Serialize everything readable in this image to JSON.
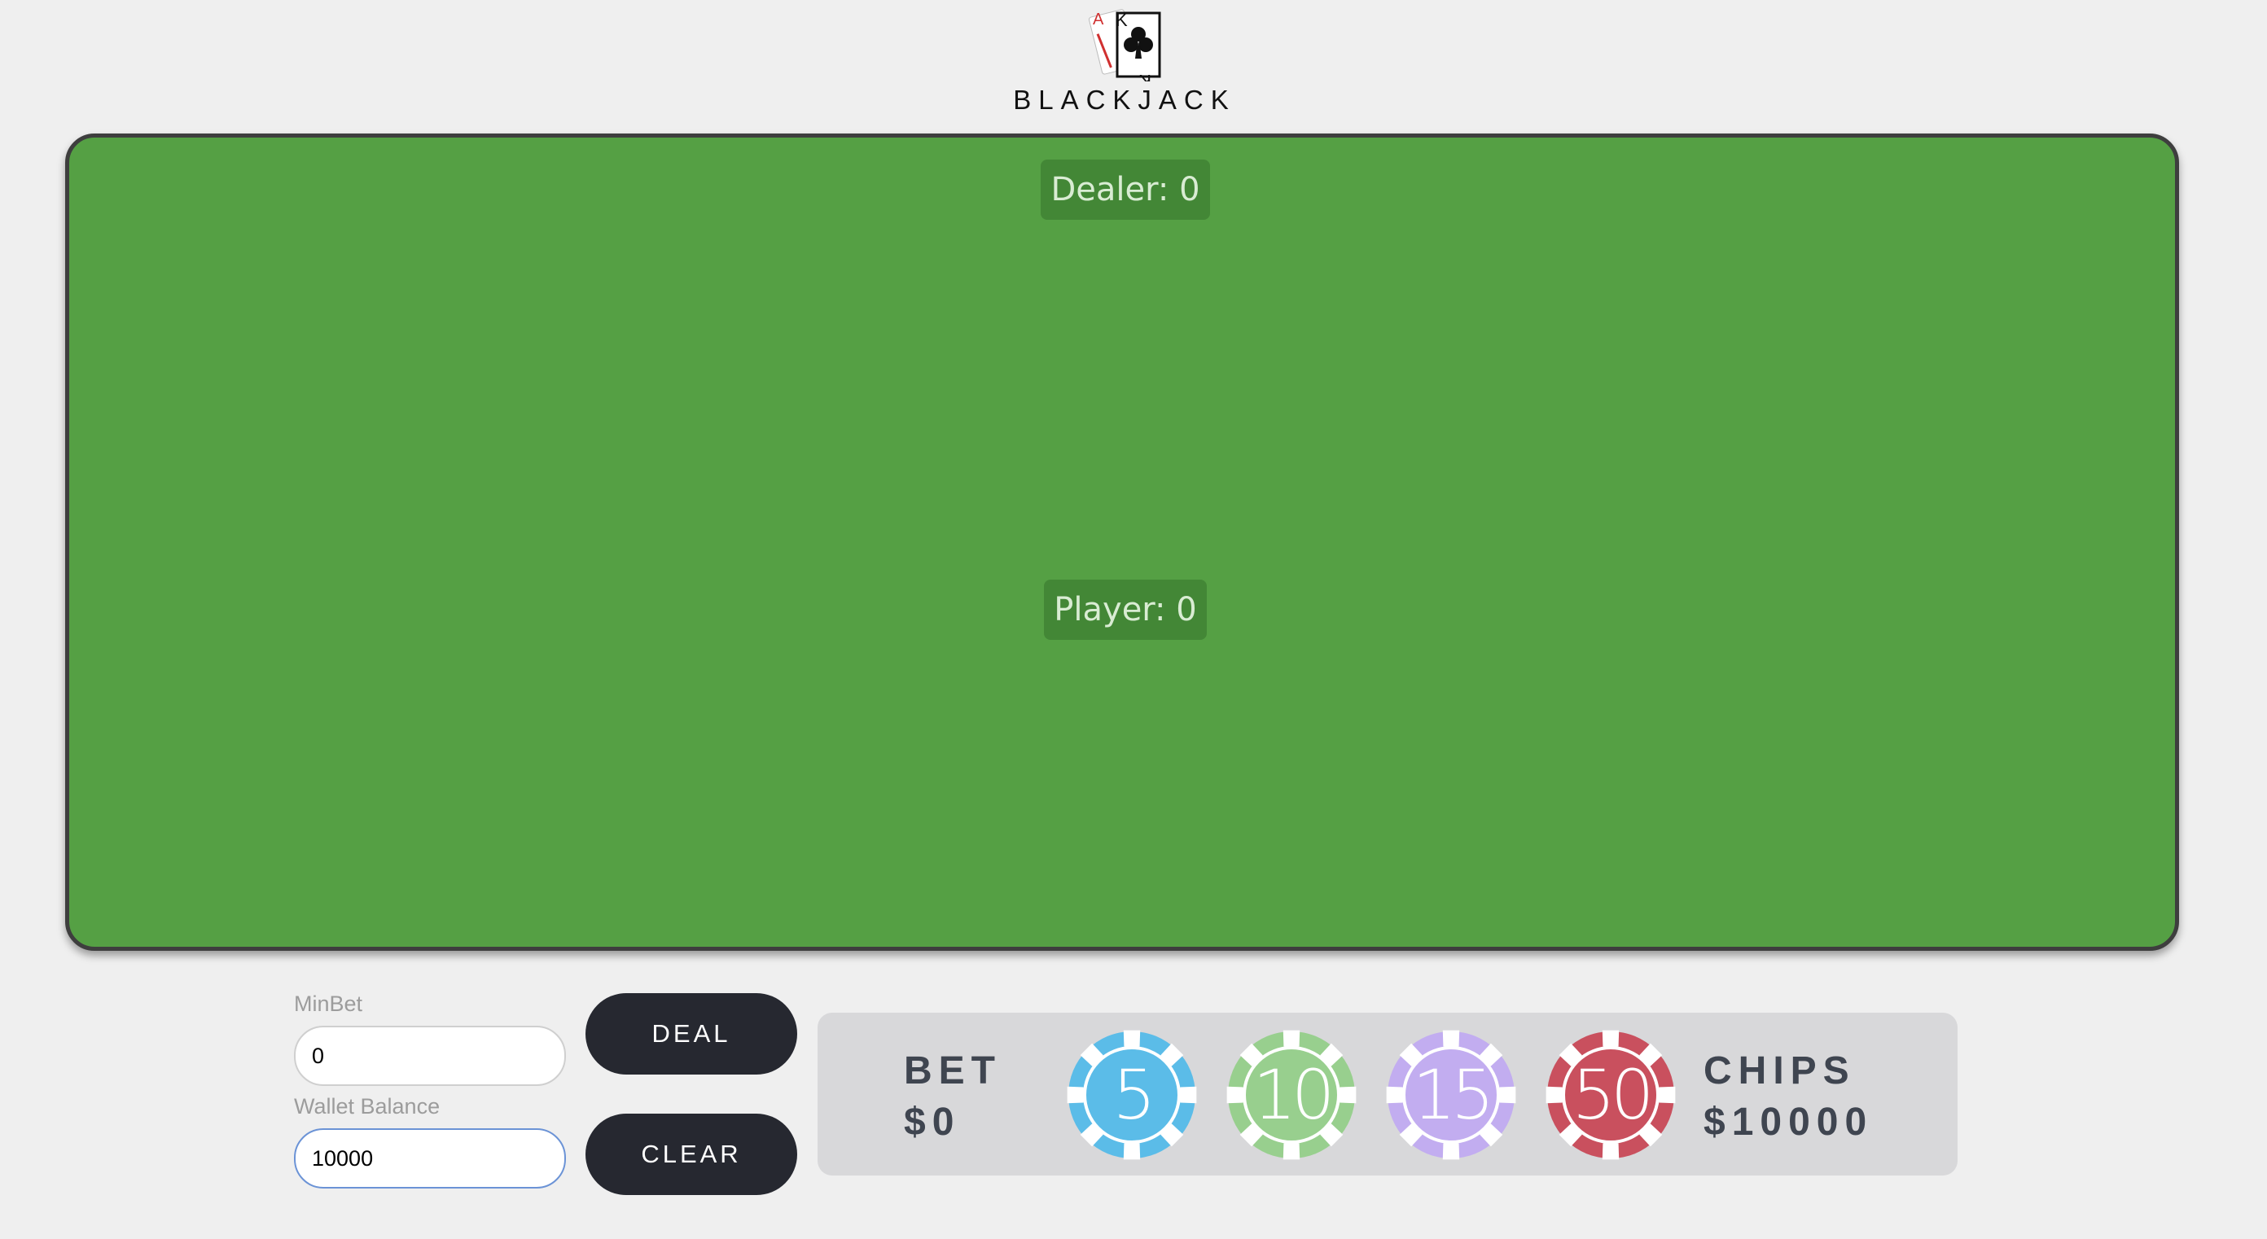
{
  "header": {
    "title": "BLACKJACK",
    "logo_icon": "ace-king-of-clubs-cards-icon",
    "logo_letters": [
      "A",
      "K",
      "K"
    ]
  },
  "table": {
    "felt_color": "#55a044",
    "dealer_score": "Dealer: 0",
    "player_score": "Player: 0"
  },
  "controls": {
    "minbet_label": "MinBet",
    "minbet_value": "0",
    "wallet_label": "Wallet Balance",
    "wallet_value": "10000",
    "deal_label": "DEAL",
    "clear_label": "CLEAR"
  },
  "bet_panel": {
    "bet_label": "BET",
    "bet_value": "$0",
    "chips_label": "CHIPS",
    "chips_value": "$10000",
    "chips": [
      {
        "value": "5",
        "color": "#5bbce8"
      },
      {
        "value": "10",
        "color": "#98cf8e"
      },
      {
        "value": "15",
        "color": "#c2adf0"
      },
      {
        "value": "50",
        "color": "#c9505e"
      }
    ]
  }
}
